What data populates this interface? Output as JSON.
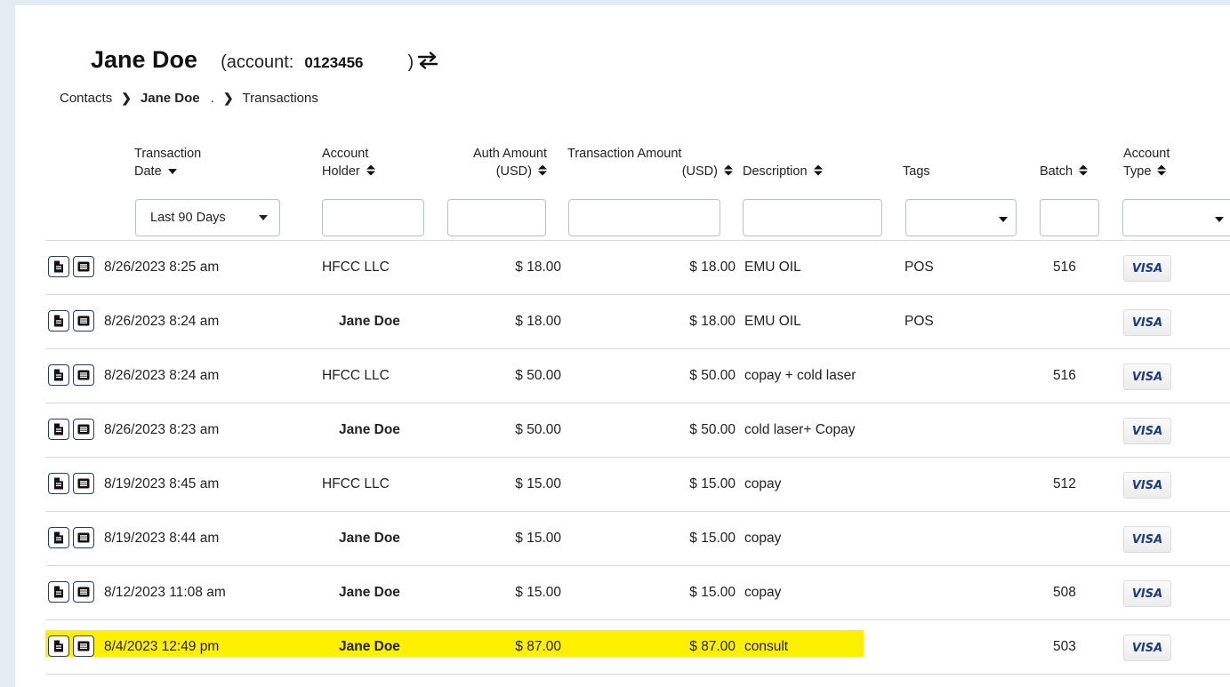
{
  "header": {
    "contact_name": "Jane Doe",
    "account_open": "(account:",
    "account_number": "0123456",
    "account_close": ")"
  },
  "breadcrumb": {
    "contacts": "Contacts",
    "contact": "Jane Doe",
    "dot": ".",
    "current": "Transactions"
  },
  "columns": {
    "date_l1": "Transaction",
    "date_l2": "Date",
    "holder_l1": "Account",
    "holder_l2": "Holder",
    "auth_l1": "Auth Amount",
    "auth_l2": "(USD)",
    "txn_l1": "Transaction Amount",
    "txn_l2": "(USD)",
    "description": "Description",
    "tags": "Tags",
    "batch": "Batch",
    "type_l1": "Account",
    "type_l2": "Type"
  },
  "filters": {
    "date_range": "Last 90 Days",
    "account_holder": "",
    "auth_amount": "",
    "transaction_amount": "",
    "description": "",
    "tags": "",
    "batch": "",
    "account_type": ""
  },
  "rows": [
    {
      "date": "8/26/2023 8:25 am",
      "holder": "HFCC LLC",
      "holder_bold": false,
      "auth": "$ 18.00",
      "amount": "$ 18.00",
      "description": "EMU OIL",
      "tags": "POS",
      "batch": "516",
      "card": "VISA",
      "highlight": false
    },
    {
      "date": "8/26/2023 8:24 am",
      "holder": "Jane Doe",
      "holder_bold": true,
      "auth": "$ 18.00",
      "amount": "$ 18.00",
      "description": "EMU OIL",
      "tags": "POS",
      "batch": "",
      "card": "VISA",
      "highlight": false
    },
    {
      "date": "8/26/2023 8:24 am",
      "holder": "HFCC LLC",
      "holder_bold": false,
      "auth": "$ 50.00",
      "amount": "$ 50.00",
      "description": "copay + cold laser",
      "tags": "",
      "batch": "516",
      "card": "VISA",
      "highlight": false
    },
    {
      "date": "8/26/2023 8:23 am",
      "holder": "Jane Doe",
      "holder_bold": true,
      "auth": "$ 50.00",
      "amount": "$ 50.00",
      "description": "cold laser+ Copay",
      "tags": "",
      "batch": "",
      "card": "VISA",
      "highlight": false
    },
    {
      "date": "8/19/2023 8:45 am",
      "holder": "HFCC LLC",
      "holder_bold": false,
      "auth": "$ 15.00",
      "amount": "$ 15.00",
      "description": "copay",
      "tags": "",
      "batch": "512",
      "card": "VISA",
      "highlight": false
    },
    {
      "date": "8/19/2023 8:44 am",
      "holder": "Jane Doe",
      "holder_bold": true,
      "auth": "$ 15.00",
      "amount": "$ 15.00",
      "description": "copay",
      "tags": "",
      "batch": "",
      "card": "VISA",
      "highlight": false
    },
    {
      "date": "8/12/2023 11:08 am",
      "holder": "Jane Doe",
      "holder_bold": true,
      "auth": "$ 15.00",
      "amount": "$ 15.00",
      "description": "copay",
      "tags": "",
      "batch": "508",
      "card": "VISA",
      "highlight": false
    },
    {
      "date": "8/4/2023 12:49 pm",
      "holder": "Jane Doe",
      "holder_bold": true,
      "auth": "$ 87.00",
      "amount": "$ 87.00",
      "description": "consult",
      "tags": "",
      "batch": "503",
      "card": "VISA",
      "highlight": true
    }
  ],
  "icons": {
    "swap": "swap-arrows-icon",
    "receipt": "document-icon",
    "details": "list-icon",
    "sort": "sort-icon",
    "sort_desc": "sort-desc-icon"
  },
  "colors": {
    "highlight": "#fff000",
    "icon_border": "#1d3f63",
    "visa_text": "#1a3a8a",
    "page_bg": "#e4ecf3"
  }
}
